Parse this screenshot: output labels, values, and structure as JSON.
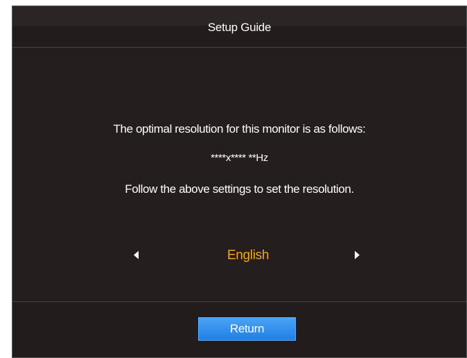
{
  "header": {
    "title": "Setup Guide"
  },
  "main": {
    "resolution_intro": "The optimal resolution for this monitor is as follows:",
    "resolution_value": "****x**** **Hz",
    "instruction": "Follow the above settings to set the resolution.",
    "language": {
      "selected": "English",
      "accent_color": "#f0a81f"
    }
  },
  "footer": {
    "return_label": "Return"
  },
  "colors": {
    "panel_background": "#241e1e",
    "button_blue": "#2a8aee",
    "text": "#ffffff"
  }
}
